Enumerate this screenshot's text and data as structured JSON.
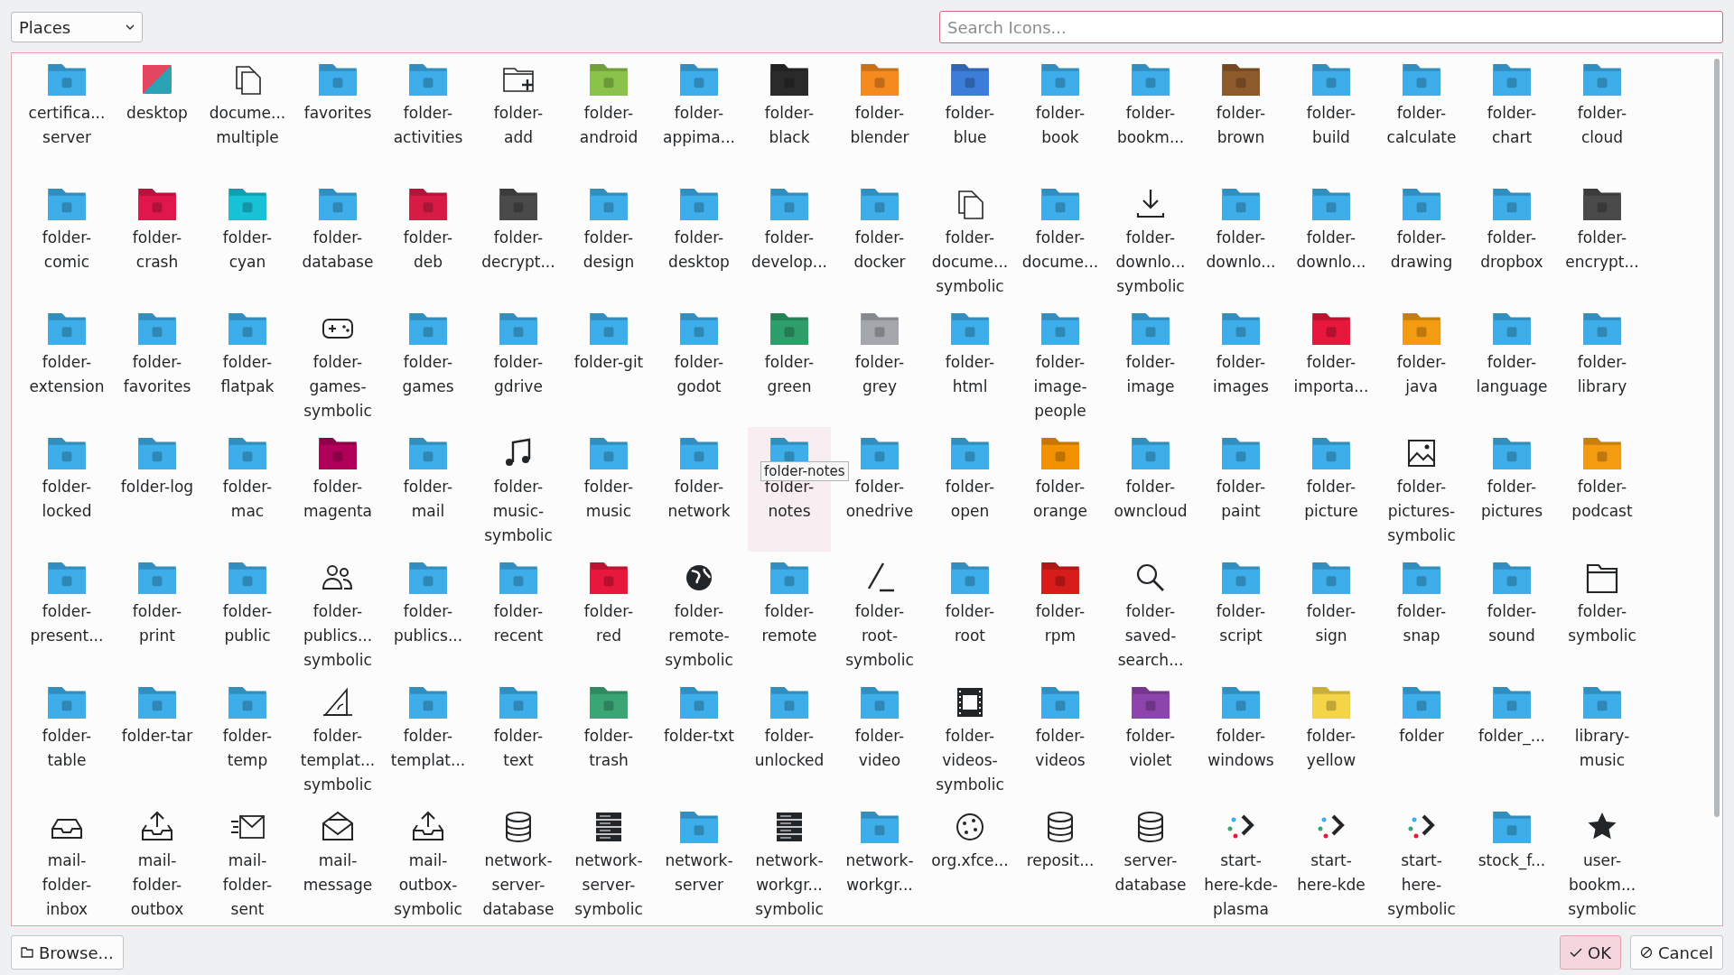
{
  "places_dropdown": {
    "value": "Places"
  },
  "search": {
    "placeholder": "Search Icons..."
  },
  "items": [
    {
      "label": "certifica...\nserver",
      "kind": "folder",
      "color": "#3daee9",
      "selected": false
    },
    {
      "label": "desktop",
      "kind": "desktop",
      "selected": false
    },
    {
      "label": "docume...\nmultiple",
      "kind": "documents",
      "selected": false
    },
    {
      "label": "favorites",
      "kind": "folder",
      "color": "#3daee9",
      "selected": false
    },
    {
      "label": "folder-\nactivities",
      "kind": "folder",
      "color": "#3daee9",
      "selected": false
    },
    {
      "label": "folder-\nadd",
      "kind": "folder-plus",
      "selected": false
    },
    {
      "label": "folder-\nandroid",
      "kind": "folder",
      "color": "#8bc34a",
      "selected": false
    },
    {
      "label": "folder-\nappima...",
      "kind": "folder",
      "color": "#3daee9",
      "selected": false
    },
    {
      "label": "folder-\nblack",
      "kind": "folder",
      "color": "#2a2a2a",
      "selected": false
    },
    {
      "label": "folder-\nblender",
      "kind": "folder",
      "color": "#f58a1f",
      "selected": false
    },
    {
      "label": "folder-\nblue",
      "kind": "folder",
      "color": "#3b7dd8",
      "selected": false
    },
    {
      "label": "folder-\nbook",
      "kind": "folder",
      "color": "#3daee9",
      "selected": false
    },
    {
      "label": "folder-\nbookm...",
      "kind": "folder",
      "color": "#3daee9",
      "selected": false
    },
    {
      "label": "folder-\nbrown",
      "kind": "folder",
      "color": "#8d5a2b",
      "selected": false
    },
    {
      "label": "folder-\nbuild",
      "kind": "folder",
      "color": "#3daee9",
      "selected": false
    },
    {
      "label": "folder-\ncalculate",
      "kind": "folder",
      "color": "#3daee9",
      "selected": false
    },
    {
      "label": "folder-\nchart",
      "kind": "folder",
      "color": "#3daee9",
      "selected": false
    },
    {
      "label": "folder-\ncloud",
      "kind": "folder",
      "color": "#3daee9",
      "selected": false
    },
    {
      "label": "folder-\ncomic",
      "kind": "folder",
      "color": "#3daee9",
      "selected": false
    },
    {
      "label": "folder-\ncrash",
      "kind": "folder",
      "color": "#e0174a",
      "selected": false
    },
    {
      "label": "folder-\ncyan",
      "kind": "folder",
      "color": "#17c1d6",
      "selected": false
    },
    {
      "label": "folder-\ndatabase",
      "kind": "folder",
      "color": "#3daee9",
      "selected": false
    },
    {
      "label": "folder-\ndeb",
      "kind": "folder",
      "color": "#d81b45",
      "selected": false
    },
    {
      "label": "folder-\ndecrypt...",
      "kind": "folder",
      "color": "#4a4a4a",
      "selected": false
    },
    {
      "label": "folder-\ndesign",
      "kind": "folder",
      "color": "#3daee9",
      "selected": false
    },
    {
      "label": "folder-\ndesktop",
      "kind": "folder",
      "color": "#3daee9",
      "selected": false
    },
    {
      "label": "folder-\ndevelop...",
      "kind": "folder",
      "color": "#3daee9",
      "selected": false
    },
    {
      "label": "folder-\ndocker",
      "kind": "folder",
      "color": "#3daee9",
      "selected": false
    },
    {
      "label": "folder-\ndocume...\nsymbolic",
      "kind": "documents",
      "selected": false
    },
    {
      "label": "folder-\ndocume...",
      "kind": "folder",
      "color": "#3daee9",
      "selected": false
    },
    {
      "label": "folder-\ndownlo...\nsymbolic",
      "kind": "download",
      "selected": false
    },
    {
      "label": "folder-\ndownlo...",
      "kind": "folder",
      "color": "#3daee9",
      "selected": false
    },
    {
      "label": "folder-\ndownlo...",
      "kind": "folder",
      "color": "#3daee9",
      "selected": false
    },
    {
      "label": "folder-\ndrawing",
      "kind": "folder",
      "color": "#3daee9",
      "selected": false
    },
    {
      "label": "folder-\ndropbox",
      "kind": "folder",
      "color": "#3daee9",
      "selected": false
    },
    {
      "label": "folder-\nencrypt...",
      "kind": "folder",
      "color": "#4a4a4a",
      "selected": false
    },
    {
      "label": "folder-\nextension",
      "kind": "folder",
      "color": "#3daee9",
      "selected": false
    },
    {
      "label": "folder-\nfavorites",
      "kind": "folder",
      "color": "#3daee9",
      "selected": false
    },
    {
      "label": "folder-\nflatpak",
      "kind": "folder",
      "color": "#3daee9",
      "selected": false
    },
    {
      "label": "folder-\ngames-\nsymbolic",
      "kind": "gamepad",
      "selected": false
    },
    {
      "label": "folder-\ngames",
      "kind": "folder",
      "color": "#3daee9",
      "selected": false
    },
    {
      "label": "folder-\ngdrive",
      "kind": "folder",
      "color": "#3daee9",
      "selected": false
    },
    {
      "label": "folder-git",
      "kind": "folder",
      "color": "#3daee9",
      "selected": false
    },
    {
      "label": "folder-\ngodot",
      "kind": "folder",
      "color": "#3daee9",
      "selected": false
    },
    {
      "label": "folder-\ngreen",
      "kind": "folder",
      "color": "#2e9e6a",
      "selected": false
    },
    {
      "label": "folder-\ngrey",
      "kind": "folder",
      "color": "#a4a8ac",
      "selected": false
    },
    {
      "label": "folder-\nhtml",
      "kind": "folder",
      "color": "#3daee9",
      "selected": false
    },
    {
      "label": "folder-\nimage-\npeople",
      "kind": "folder",
      "color": "#3daee9",
      "selected": false
    },
    {
      "label": "folder-\nimage",
      "kind": "folder",
      "color": "#3daee9",
      "selected": false
    },
    {
      "label": "folder-\nimages",
      "kind": "folder",
      "color": "#3daee9",
      "selected": false
    },
    {
      "label": "folder-\nimporta...",
      "kind": "folder",
      "color": "#e8173c",
      "selected": false
    },
    {
      "label": "folder-\njava",
      "kind": "folder",
      "color": "#f39c12",
      "selected": false
    },
    {
      "label": "folder-\nlanguage",
      "kind": "folder",
      "color": "#3daee9",
      "selected": false
    },
    {
      "label": "folder-\nlibrary",
      "kind": "folder",
      "color": "#3daee9",
      "selected": false
    },
    {
      "label": "folder-\nlocked",
      "kind": "folder",
      "color": "#3daee9",
      "selected": false
    },
    {
      "label": "folder-log",
      "kind": "folder",
      "color": "#3daee9",
      "selected": false
    },
    {
      "label": "folder-\nmac",
      "kind": "folder",
      "color": "#3daee9",
      "selected": false
    },
    {
      "label": "folder-\nmagenta",
      "kind": "folder",
      "color": "#b0005a",
      "selected": false
    },
    {
      "label": "folder-\nmail",
      "kind": "folder",
      "color": "#3daee9",
      "selected": false
    },
    {
      "label": "folder-\nmusic-\nsymbolic",
      "kind": "music",
      "selected": false
    },
    {
      "label": "folder-\nmusic",
      "kind": "folder",
      "color": "#3daee9",
      "selected": false
    },
    {
      "label": "folder-\nnetwork",
      "kind": "folder",
      "color": "#3daee9",
      "selected": false
    },
    {
      "label": "folder-\nnotes",
      "kind": "folder",
      "color": "#3daee9",
      "selected": true
    },
    {
      "label": "folder-\nonedrive",
      "kind": "folder",
      "color": "#3daee9",
      "selected": false
    },
    {
      "label": "folder-\nopen",
      "kind": "folder",
      "color": "#3daee9",
      "selected": false
    },
    {
      "label": "folder-\norange",
      "kind": "folder",
      "color": "#f39200",
      "selected": false
    },
    {
      "label": "folder-\nowncloud",
      "kind": "folder",
      "color": "#3daee9",
      "selected": false
    },
    {
      "label": "folder-\npaint",
      "kind": "folder",
      "color": "#3daee9",
      "selected": false
    },
    {
      "label": "folder-\npicture",
      "kind": "folder",
      "color": "#3daee9",
      "selected": false
    },
    {
      "label": "folder-\npictures-\nsymbolic",
      "kind": "image",
      "selected": false
    },
    {
      "label": "folder-\npictures",
      "kind": "folder",
      "color": "#3daee9",
      "selected": false
    },
    {
      "label": "folder-\npodcast",
      "kind": "folder",
      "color": "#f39c12",
      "selected": false
    },
    {
      "label": "folder-\npresent...",
      "kind": "folder",
      "color": "#3daee9",
      "selected": false
    },
    {
      "label": "folder-\nprint",
      "kind": "folder",
      "color": "#3daee9",
      "selected": false
    },
    {
      "label": "folder-\npublic",
      "kind": "folder",
      "color": "#3daee9",
      "selected": false
    },
    {
      "label": "folder-\npublics...\nsymbolic",
      "kind": "people",
      "selected": false
    },
    {
      "label": "folder-\npublics...",
      "kind": "folder",
      "color": "#3daee9",
      "selected": false
    },
    {
      "label": "folder-\nrecent",
      "kind": "folder",
      "color": "#3daee9",
      "selected": false
    },
    {
      "label": "folder-\nred",
      "kind": "folder",
      "color": "#e8173c",
      "selected": false
    },
    {
      "label": "folder-\nremote-\nsymbolic",
      "kind": "globe",
      "selected": false
    },
    {
      "label": "folder-\nremote",
      "kind": "folder",
      "color": "#3daee9",
      "selected": false
    },
    {
      "label": "folder-\nroot-\nsymbolic",
      "kind": "slash",
      "selected": false
    },
    {
      "label": "folder-\nroot",
      "kind": "folder",
      "color": "#3daee9",
      "selected": false
    },
    {
      "label": "folder-\nrpm",
      "kind": "folder",
      "color": "#d81b1b",
      "selected": false
    },
    {
      "label": "folder-\nsaved-\nsearch...",
      "kind": "search",
      "selected": false
    },
    {
      "label": "folder-\nscript",
      "kind": "folder",
      "color": "#3daee9",
      "selected": false
    },
    {
      "label": "folder-\nsign",
      "kind": "folder",
      "color": "#3daee9",
      "selected": false
    },
    {
      "label": "folder-\nsnap",
      "kind": "folder",
      "color": "#3daee9",
      "selected": false
    },
    {
      "label": "folder-\nsound",
      "kind": "folder",
      "color": "#3daee9",
      "selected": false
    },
    {
      "label": "folder-\nsymbolic",
      "kind": "folder-outline",
      "selected": false
    },
    {
      "label": "folder-\ntable",
      "kind": "folder",
      "color": "#3daee9",
      "selected": false
    },
    {
      "label": "folder-tar",
      "kind": "folder",
      "color": "#3daee9",
      "selected": false
    },
    {
      "label": "folder-\ntemp",
      "kind": "folder",
      "color": "#3daee9",
      "selected": false
    },
    {
      "label": "folder-\ntemplat...\nsymbolic",
      "kind": "ruler",
      "selected": false
    },
    {
      "label": "folder-\ntemplat...",
      "kind": "folder",
      "color": "#3daee9",
      "selected": false
    },
    {
      "label": "folder-\ntext",
      "kind": "folder",
      "color": "#3daee9",
      "selected": false
    },
    {
      "label": "folder-\ntrash",
      "kind": "folder",
      "color": "#3aa676",
      "selected": false
    },
    {
      "label": "folder-txt",
      "kind": "folder",
      "color": "#3daee9",
      "selected": false
    },
    {
      "label": "folder-\nunlocked",
      "kind": "folder",
      "color": "#3daee9",
      "selected": false
    },
    {
      "label": "folder-\nvideo",
      "kind": "folder",
      "color": "#3daee9",
      "selected": false
    },
    {
      "label": "folder-\nvideos-\nsymbolic",
      "kind": "film",
      "selected": false
    },
    {
      "label": "folder-\nvideos",
      "kind": "folder",
      "color": "#3daee9",
      "selected": false
    },
    {
      "label": "folder-\nviolet",
      "kind": "folder",
      "color": "#8e44ad",
      "selected": false
    },
    {
      "label": "folder-\nwindows",
      "kind": "folder",
      "color": "#3daee9",
      "selected": false
    },
    {
      "label": "folder-\nyellow",
      "kind": "folder",
      "color": "#f5d547",
      "selected": false
    },
    {
      "label": "folder",
      "kind": "folder",
      "color": "#3daee9",
      "selected": false
    },
    {
      "label": "folder_...",
      "kind": "folder",
      "color": "#3daee9",
      "selected": false
    },
    {
      "label": "library-\nmusic",
      "kind": "folder",
      "color": "#3daee9",
      "selected": false
    },
    {
      "label": "mail-\nfolder-\ninbox",
      "kind": "tray",
      "selected": false
    },
    {
      "label": "mail-\nfolder-\noutbox",
      "kind": "tray-up",
      "selected": false
    },
    {
      "label": "mail-\nfolder-\nsent",
      "kind": "mail-send",
      "selected": false
    },
    {
      "label": "mail-\nmessage",
      "kind": "envelope",
      "selected": false
    },
    {
      "label": "mail-\noutbox-\nsymbolic",
      "kind": "tray-up",
      "selected": false
    },
    {
      "label": "network-\nserver-\ndatabase",
      "kind": "database",
      "selected": false
    },
    {
      "label": "network-\nserver-\nsymbolic",
      "kind": "server",
      "selected": false
    },
    {
      "label": "network-\nserver",
      "kind": "folder",
      "color": "#3daee9",
      "selected": false
    },
    {
      "label": "network-\nworkgr...\nsymbolic",
      "kind": "server",
      "selected": false
    },
    {
      "label": "network-\nworkgr...",
      "kind": "folder",
      "color": "#3daee9",
      "selected": false
    },
    {
      "label": "org.xfce...",
      "kind": "dots-circle",
      "selected": false
    },
    {
      "label": "reposit...",
      "kind": "database",
      "selected": false
    },
    {
      "label": "server-\ndatabase",
      "kind": "database",
      "selected": false
    },
    {
      "label": "start-\nhere-kde-\nplasma",
      "kind": "chevron",
      "selected": false
    },
    {
      "label": "start-\nhere-kde",
      "kind": "chevron",
      "selected": false
    },
    {
      "label": "start-\nhere-\nsymbolic",
      "kind": "chevron",
      "selected": false
    },
    {
      "label": "stock_f...",
      "kind": "folder",
      "color": "#3daee9",
      "selected": false
    },
    {
      "label": "user-\nbookm...\nsymbolic",
      "kind": "star",
      "selected": false
    }
  ],
  "tooltip": "folder-notes",
  "buttons": [
    {
      "kind": "browse",
      "label": "Browse..."
    },
    {
      "kind": "ok",
      "label": "OK"
    },
    {
      "kind": "cancel",
      "label": "Cancel"
    }
  ]
}
